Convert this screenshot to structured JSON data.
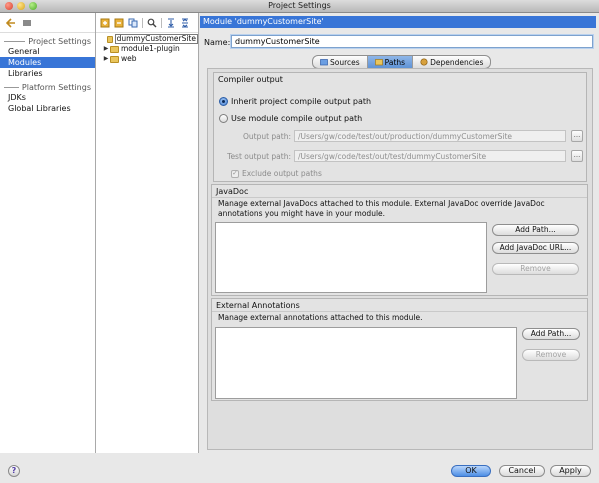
{
  "window": {
    "title": "Project Settings"
  },
  "sidebar": {
    "project_settings_header": "Project Settings",
    "project_items": [
      "General",
      "Modules",
      "Libraries"
    ],
    "platform_settings_header": "Platform Settings",
    "platform_items": [
      "JDKs",
      "Global Libraries"
    ],
    "selected": "Modules"
  },
  "tree": {
    "nodes": [
      {
        "label": "dummyCustomerSite",
        "expandable": false,
        "selected": true
      },
      {
        "label": "module1-plugin",
        "expandable": true,
        "selected": false
      },
      {
        "label": "web",
        "expandable": true,
        "selected": false
      }
    ]
  },
  "header": {
    "title": "Module 'dummyCustomerSite'"
  },
  "name_field": {
    "label": "Name:",
    "value": "dummyCustomerSite"
  },
  "tabs": [
    {
      "label": "Sources",
      "icon": "folder-icon",
      "active": false
    },
    {
      "label": "Paths",
      "icon": "paths-icon",
      "active": true
    },
    {
      "label": "Dependencies",
      "icon": "dependencies-icon",
      "active": false
    }
  ],
  "compiler_output": {
    "title": "Compiler output",
    "inherit_label": "Inherit project compile output path",
    "module_label": "Use module compile output path",
    "selected": "inherit",
    "output_path_label": "Output path:",
    "output_path_value": "/Users/gw/code/test/out/production/dummyCustomerSite",
    "test_output_path_label": "Test output path:",
    "test_output_path_value": "/Users/gw/code/test/out/test/dummyCustomerSite",
    "browse_label": "...",
    "exclude_label": "Exclude output paths",
    "exclude_checked": true
  },
  "javadoc": {
    "title": "JavaDoc",
    "description": "Manage external JavaDocs attached to this module. External JavaDoc override JavaDoc annotations you might have in your module.",
    "add_path": "Add Path...",
    "add_url": "Add JavaDoc URL...",
    "remove": "Remove"
  },
  "external_annotations": {
    "title": "External Annotations",
    "description": "Manage external annotations attached to this module.",
    "add_path": "Add Path...",
    "remove": "Remove"
  },
  "footer": {
    "help": "?",
    "ok": "OK",
    "cancel": "Cancel",
    "apply": "Apply"
  },
  "colors": {
    "selection": "#3875d7",
    "panel_bg": "#e8e8e8"
  }
}
